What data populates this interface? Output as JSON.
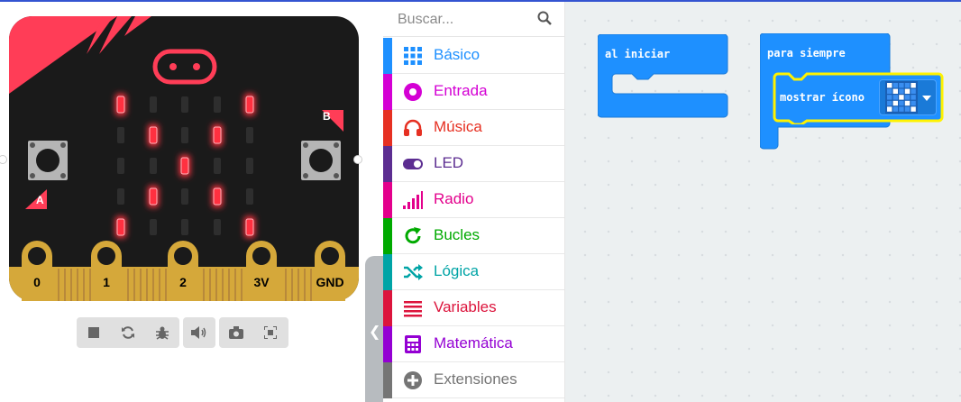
{
  "colors": {
    "accent": "#3454d1",
    "board": "#1a1a1a",
    "board_corner": "#ff3d57",
    "gold": "#d5a83a",
    "led_on": "#ff3040",
    "led_off": "#2e2e2e",
    "block_basic": "#1e90ff",
    "toolbox_hover": "#f2f2f2",
    "workspace": "#ecf0f1",
    "highlight": "#fff200"
  },
  "simulator": {
    "pins": [
      "0",
      "1",
      "2",
      "3V",
      "GND"
    ],
    "button_a": "A",
    "button_b": "B",
    "led_matrix": [
      [
        1,
        0,
        0,
        0,
        1
      ],
      [
        0,
        1,
        0,
        1,
        0
      ],
      [
        0,
        0,
        1,
        0,
        0
      ],
      [
        0,
        1,
        0,
        1,
        0
      ],
      [
        1,
        0,
        0,
        0,
        1
      ]
    ],
    "controls": [
      {
        "name": "stop",
        "icon": "stop-icon"
      },
      {
        "name": "restart",
        "icon": "restart-icon"
      },
      {
        "name": "debug",
        "icon": "bug-icon"
      },
      {
        "name": "sound",
        "icon": "volume-icon"
      },
      {
        "name": "screenshot",
        "icon": "camera-icon"
      },
      {
        "name": "fullscreen",
        "icon": "fullscreen-icon"
      }
    ]
  },
  "toolbox": {
    "search_placeholder": "Buscar...",
    "categories": [
      {
        "label": "Básico",
        "color": "#1e90ff",
        "icon": "grid-icon"
      },
      {
        "label": "Entrada",
        "color": "#d400d4",
        "icon": "circle-dot-icon"
      },
      {
        "label": "Música",
        "color": "#e63022",
        "icon": "headphones-icon"
      },
      {
        "label": "LED",
        "color": "#5c2d91",
        "icon": "toggle-icon"
      },
      {
        "label": "Radio",
        "color": "#e3008c",
        "icon": "signal-bars-icon"
      },
      {
        "label": "Bucles",
        "color": "#00aa00",
        "icon": "refresh-icon"
      },
      {
        "label": "Lógica",
        "color": "#00a4a6",
        "icon": "shuffle-icon"
      },
      {
        "label": "Variables",
        "color": "#dc143c",
        "icon": "list-icon"
      },
      {
        "label": "Matemática",
        "color": "#9400d3",
        "icon": "calculator-icon"
      },
      {
        "label": "Extensiones",
        "color": "#757575",
        "icon": "plus-circle-icon"
      }
    ]
  },
  "workspace": {
    "on_start_label": "al iniciar",
    "forever_label": "para siempre",
    "show_icon_label": "mostrar ícono",
    "icon_value": "no",
    "icon_matrix": [
      [
        1,
        0,
        0,
        0,
        1
      ],
      [
        0,
        1,
        0,
        1,
        0
      ],
      [
        0,
        0,
        1,
        0,
        0
      ],
      [
        0,
        1,
        0,
        1,
        0
      ],
      [
        1,
        0,
        0,
        0,
        1
      ]
    ]
  }
}
